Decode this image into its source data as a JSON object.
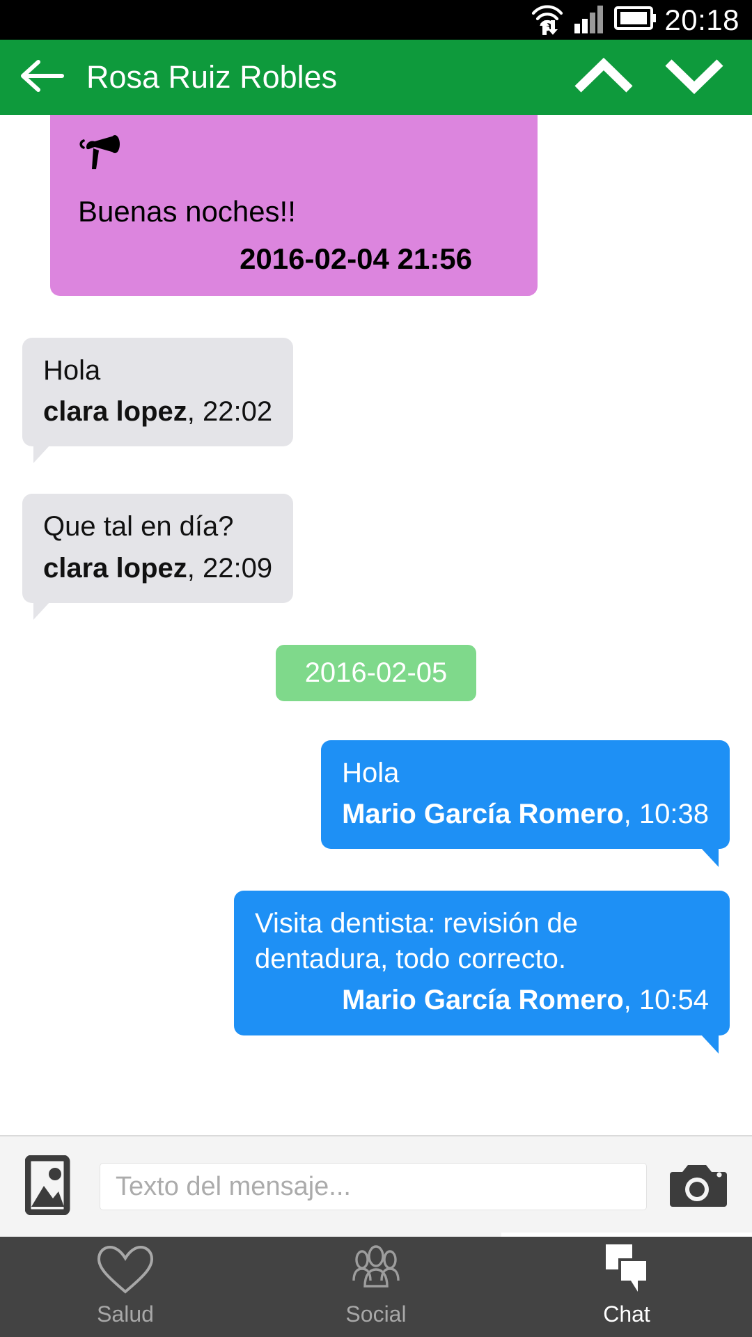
{
  "status_bar": {
    "time": "20:18",
    "icons": [
      "wifi-data-icon",
      "signal-bars-icon",
      "battery-icon"
    ]
  },
  "app_bar": {
    "back_icon": "arrow-left-icon",
    "title": "Rosa Ruiz Robles",
    "up_icon": "chevron-up-icon",
    "down_icon": "chevron-down-icon",
    "background_color": "#0E9A3C"
  },
  "messages": [
    {
      "type": "announcement",
      "icon": "megaphone-icon",
      "text": "Buenas noches!!",
      "timestamp": "2016-02-04 21:56",
      "color": "#DC85DE"
    },
    {
      "type": "incoming",
      "text": "Hola",
      "sender": "clara lopez",
      "time": ", 22:02",
      "color": "#E4E4E8"
    },
    {
      "type": "incoming",
      "text": "Que tal en día?",
      "sender": "clara lopez",
      "time": ", 22:09",
      "color": "#E4E4E8"
    },
    {
      "type": "date_separator",
      "label": "2016-02-05",
      "color": "#7FD98B"
    },
    {
      "type": "outgoing",
      "text": "Hola",
      "sender": "Mario García Romero",
      "time": ", 10:38",
      "color": "#1E90F5"
    },
    {
      "type": "outgoing",
      "text": "Visita dentista: revisión de dentadura, todo correcto.",
      "sender": "Mario García Romero",
      "time": ", 10:54",
      "color": "#1E90F5"
    }
  ],
  "input_bar": {
    "gallery_icon": "image-icon",
    "placeholder": "Texto del mensaje...",
    "value": "",
    "camera_icon": "camera-icon"
  },
  "bottom_nav": {
    "tabs": [
      {
        "label": "Salud",
        "icon": "heart-icon",
        "active": false
      },
      {
        "label": "Social",
        "icon": "people-group-icon",
        "active": false
      },
      {
        "label": "Chat",
        "icon": "chat-bubbles-icon",
        "active": true
      }
    ],
    "background_color": "#434343"
  }
}
